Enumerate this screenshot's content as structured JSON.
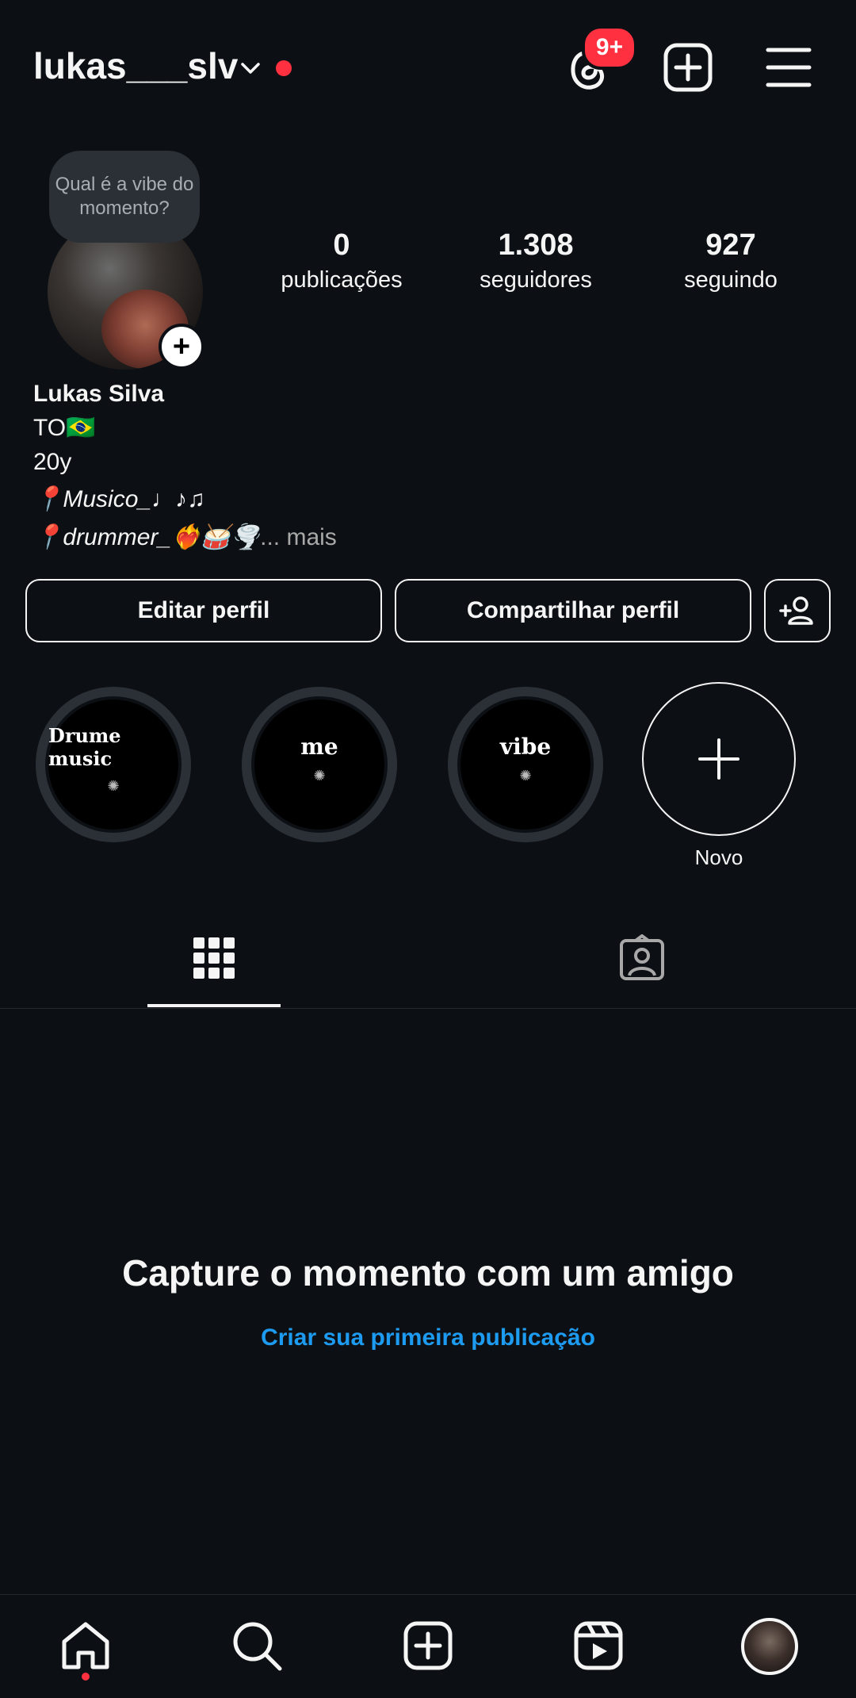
{
  "header": {
    "username": "lukas___slv",
    "threads_badge": "9+"
  },
  "profile": {
    "note": "Qual é a vibe do momento?",
    "stats": [
      {
        "value": "0",
        "label": "publicações"
      },
      {
        "value": "1.308",
        "label": "seguidores"
      },
      {
        "value": "927",
        "label": "seguindo"
      }
    ],
    "name": "Lukas Silva",
    "bio_lines": [
      "TO🇧🇷",
      "20y",
      "📍Musico_♩♪♫",
      "📍drummer_❤️‍🔥🥁🌪️"
    ],
    "bio_more": "... mais"
  },
  "actions": {
    "edit": "Editar perfil",
    "share": "Compartilhar perfil"
  },
  "highlights": [
    {
      "title": "Drume music"
    },
    {
      "title": "me"
    },
    {
      "title": "vibe"
    }
  ],
  "new_highlight_label": "Novo",
  "empty_state": {
    "title": "Capture o momento com um amigo",
    "link": "Criar sua primeira publicação"
  },
  "colors": {
    "background": "#0c1014",
    "accent_red": "#ff3040",
    "link_blue": "#1d9bf0"
  }
}
